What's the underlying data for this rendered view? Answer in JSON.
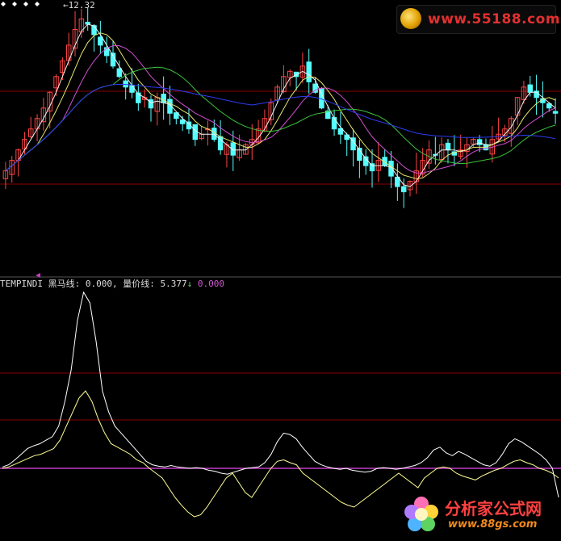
{
  "peak_label": "12.32",
  "indicator": {
    "name": "TEMPINDI",
    "black_horse_label": "黑马线",
    "black_horse_value": "0.000,",
    "volume_price_label": "量价线",
    "volume_price_value": "5.377",
    "arrow": "↓",
    "third_value": "0.000"
  },
  "watermarks": {
    "top_url": "www.55188.com",
    "bottom_cn": "分析家公式网",
    "bottom_url": "www.88gs.com",
    "logo_icon": "coin-logo-icon",
    "flower_icon": "flower-logo-icon"
  },
  "colors": {
    "up": "#ff4444",
    "down": "#55ffff",
    "ma_white": "#f0f0f0",
    "ma_yellow": "#e6e66e",
    "ma_magenta": "#d24fd2",
    "ma_green": "#3bc43b",
    "ma_blue": "#2c3cf0",
    "grid": "#8b0000",
    "volprice": "#ffffff",
    "black_horse": "#ffff96",
    "zero_line": "#c33cc3"
  },
  "chart_data": [
    {
      "type": "candlestick",
      "title": "",
      "peak_price": 12.32,
      "closes": [
        9.2,
        9.4,
        9.6,
        9.8,
        10.0,
        10.2,
        10.4,
        10.7,
        11.0,
        11.3,
        11.6,
        11.9,
        12.1,
        12.0,
        11.8,
        11.6,
        11.4,
        11.2,
        11.0,
        10.8,
        10.7,
        10.5,
        10.6,
        10.4,
        10.6,
        10.5,
        10.3,
        10.2,
        10.1,
        10.0,
        9.8,
        9.9,
        10.0,
        9.8,
        9.6,
        9.7,
        9.5,
        9.6,
        9.7,
        9.8,
        10.0,
        10.2,
        10.5,
        10.8,
        11.0,
        11.1,
        11.0,
        11.2,
        10.9,
        10.7,
        10.4,
        10.2,
        10.0,
        9.9,
        9.8,
        9.6,
        9.4,
        9.3,
        9.2,
        9.4,
        9.3,
        9.1,
        8.9,
        8.8,
        9.0,
        9.2,
        9.4,
        9.6,
        9.5,
        9.7,
        9.6,
        9.5,
        9.6,
        9.7,
        9.8,
        9.7,
        9.6,
        9.8,
        9.9,
        10.0,
        10.2,
        10.6,
        10.8,
        10.7,
        10.6,
        10.5,
        10.4,
        10.3
      ],
      "ma_lines": [
        "white-fast",
        "yellow",
        "magenta",
        "green",
        "blue-slow"
      ]
    },
    {
      "type": "line",
      "title": "",
      "series": [
        {
          "name": "量价线",
          "color": "volprice",
          "values": [
            2,
            5,
            12,
            20,
            28,
            32,
            35,
            40,
            45,
            60,
            95,
            140,
            210,
            250,
            235,
            180,
            110,
            80,
            60,
            50,
            40,
            30,
            20,
            10,
            5,
            3,
            2,
            4,
            2,
            1,
            0,
            1,
            0,
            -2,
            -3,
            -5,
            -6,
            -4,
            -2,
            0,
            1,
            2,
            8,
            20,
            38,
            50,
            48,
            42,
            30,
            20,
            10,
            5,
            2,
            0,
            -1,
            0,
            -2,
            -3,
            -4,
            -3,
            0,
            1,
            0,
            -1,
            0,
            2,
            4,
            8,
            15,
            26,
            30,
            22,
            18,
            24,
            20,
            15,
            10,
            5,
            3,
            8,
            20,
            35,
            42,
            38,
            32,
            26,
            20,
            12,
            0,
            -30
          ]
        },
        {
          "name": "黑马线",
          "color": "black_horse",
          "values": [
            0,
            2,
            6,
            10,
            14,
            18,
            20,
            24,
            28,
            40,
            60,
            80,
            100,
            110,
            95,
            70,
            50,
            35,
            30,
            25,
            20,
            12,
            8,
            0,
            -5,
            -10,
            -20,
            -30,
            -38,
            -45,
            -50,
            -48,
            -40,
            -30,
            -20,
            -10,
            -5,
            -15,
            -25,
            -30,
            -20,
            -10,
            0,
            10,
            12,
            8,
            5,
            -5,
            -10,
            -15,
            -20,
            -25,
            -30,
            -35,
            -38,
            -40,
            -35,
            -30,
            -25,
            -20,
            -15,
            -10,
            -5,
            -10,
            -15,
            -20,
            -10,
            -5,
            0,
            2,
            0,
            -5,
            -8,
            -10,
            -12,
            -8,
            -5,
            -2,
            0,
            5,
            10,
            12,
            8,
            5,
            0,
            -2,
            -5,
            -10
          ]
        }
      ],
      "zero_value": 0
    }
  ]
}
